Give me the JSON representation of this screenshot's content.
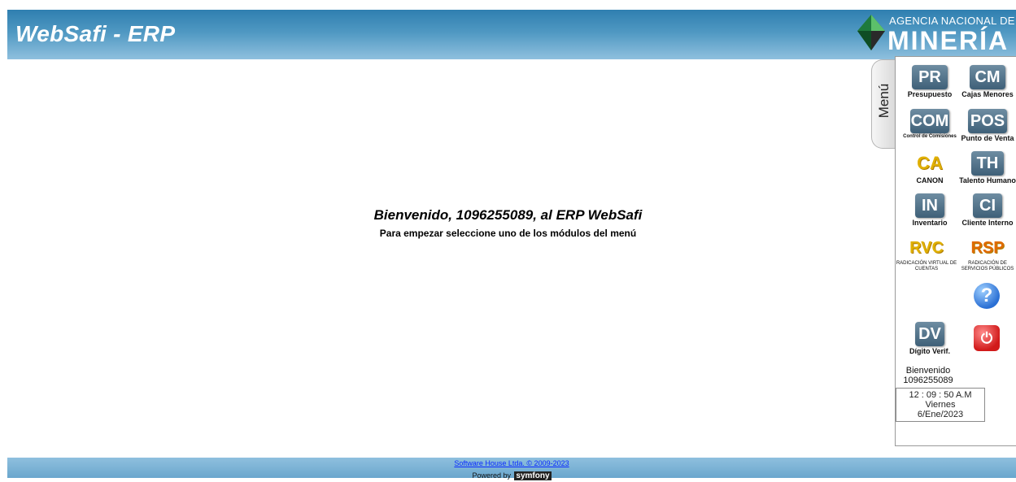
{
  "header": {
    "app_title": "WebSafi - ERP",
    "logo_small": "AGENCIA NACIONAL DE",
    "logo_big": "MINERÍA"
  },
  "welcome": {
    "title": "Bienvenido, 1096255089, al ERP WebSafi",
    "subtitle": "Para empezar seleccione uno de los módulos del menú"
  },
  "menu": {
    "tab_label": "Menú",
    "modules": [
      {
        "code": "PR",
        "label": "Presupuesto"
      },
      {
        "code": "CM",
        "label": "Cajas Menores"
      },
      {
        "code": "COM",
        "label": "Control de Comisiones"
      },
      {
        "code": "POS",
        "label": "Punto de Venta"
      },
      {
        "code": "CA",
        "label": "CANON"
      },
      {
        "code": "TH",
        "label": "Talento Humano"
      },
      {
        "code": "IN",
        "label": "Inventario"
      },
      {
        "code": "CI",
        "label": "Cliente Interno"
      },
      {
        "code": "RVC",
        "label": "RADICACIÓN VIRTUAL DE CUENTAS"
      },
      {
        "code": "RSP",
        "label": "RADICACIÓN DE SERVICIOS PÚBLICOS"
      },
      {
        "code": "DV",
        "label": "Dígito Verif."
      }
    ],
    "help_icon": "question-icon",
    "power_icon": "power-icon",
    "user_greeting": "Bienvenido",
    "user_id": "1096255089",
    "clock": {
      "time": "12 : 09 : 50 A.M",
      "day": "Viernes",
      "date": "6/Ene/2023"
    }
  },
  "footer": {
    "link": "Software House Ltda. © 2009-2023",
    "powered_by": "Powered by",
    "symfony": "symfony"
  }
}
